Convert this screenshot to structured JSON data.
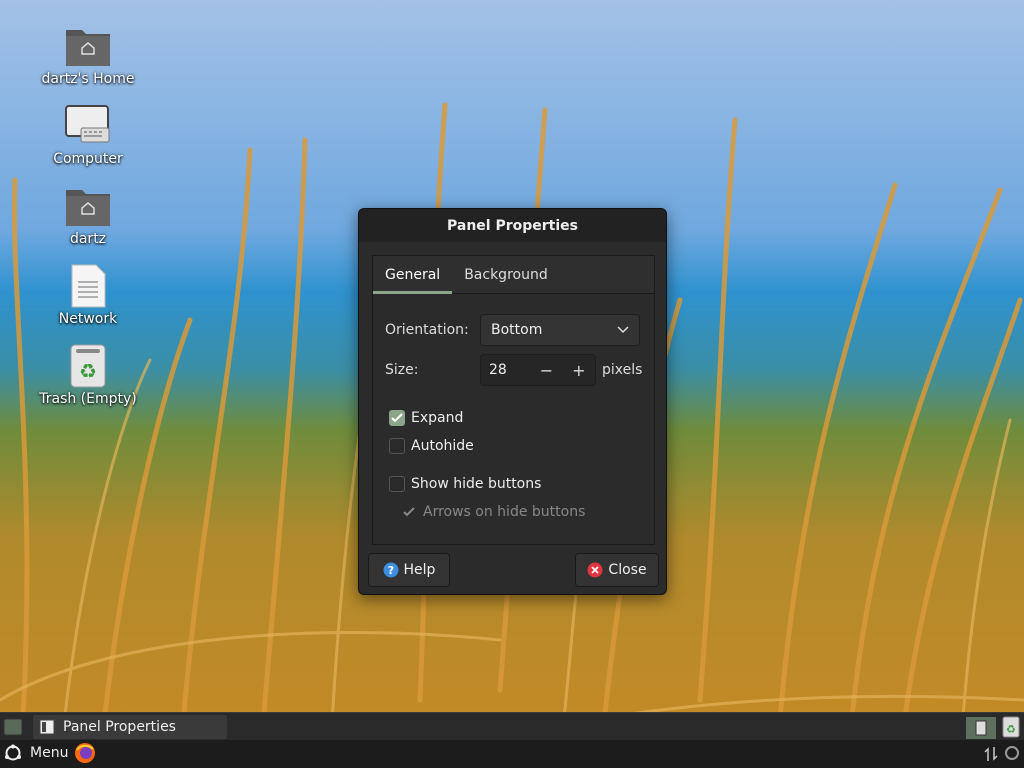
{
  "desktop": {
    "icons": [
      {
        "label": "dartz's Home",
        "icon": "home-folder-icon"
      },
      {
        "label": "Computer",
        "icon": "computer-icon"
      },
      {
        "label": "dartz",
        "icon": "home-folder-icon"
      },
      {
        "label": "Network",
        "icon": "network-document-icon"
      },
      {
        "label": "Trash (Empty)",
        "icon": "trash-icon"
      }
    ]
  },
  "dialog": {
    "title": "Panel Properties",
    "tabs": [
      {
        "label": "General",
        "active": true
      },
      {
        "label": "Background",
        "active": false
      }
    ],
    "orientation": {
      "label": "Orientation:",
      "value": "Bottom"
    },
    "size": {
      "label": "Size:",
      "value": "28",
      "unit": "pixels",
      "minus": "−",
      "plus": "+"
    },
    "checkboxes": [
      {
        "label": "Expand",
        "checked": true
      },
      {
        "label": "Autohide",
        "checked": false
      },
      {
        "label": "Show hide buttons",
        "checked": false
      },
      {
        "label": "Arrows on hide buttons",
        "checked": true,
        "disabled": true
      }
    ],
    "help_label": "Help",
    "close_label": "Close"
  },
  "taskbar": {
    "window_button": "Panel Properties",
    "menu_label": "Menu"
  },
  "colors": {
    "accent": "#8aa58a",
    "dialog_bg": "#2b2b2b",
    "taskbar_bg": "#1f1f1f",
    "close_red": "#e0353e",
    "help_blue": "#3d8ee0"
  }
}
